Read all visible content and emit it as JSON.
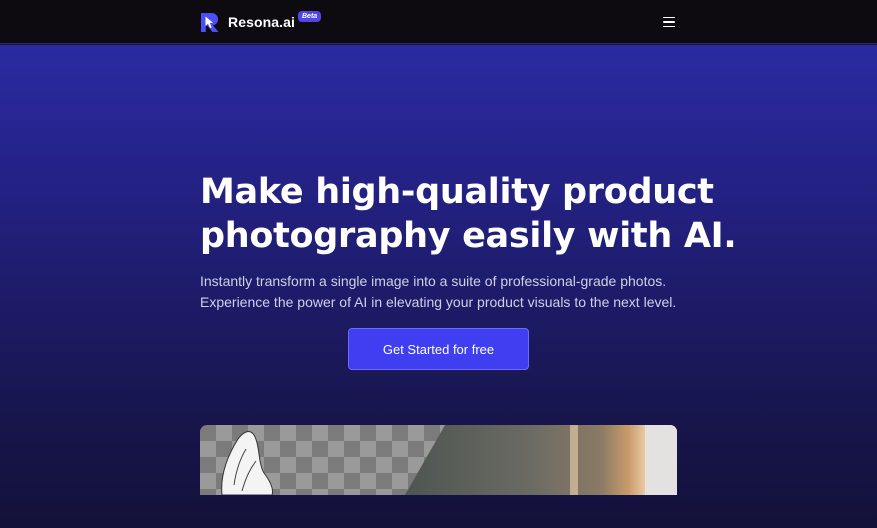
{
  "nav": {
    "brand_name": "Resona.ai",
    "beta_label": "Beta",
    "logo_icon": "resona-logo-icon",
    "menu_icon": "hamburger-menu-icon"
  },
  "hero": {
    "headline_line1": "Make high-quality product",
    "headline_line2": "photography easily with AI.",
    "subtext_line1": "Instantly transform a single image into a suite of professional-grade photos.",
    "subtext_line2": "Experience the power of AI in elevating your product visuals to the next level.",
    "cta_label": "Get Started for free"
  },
  "preview": {
    "image_icon": "product-preview-image"
  },
  "colors": {
    "navbar": "#0d0b0f",
    "hero_top": "#2b2ba2",
    "hero_bottom": "#131139",
    "accent": "#3f3ef0",
    "beta_badge": "#4f46e5"
  }
}
